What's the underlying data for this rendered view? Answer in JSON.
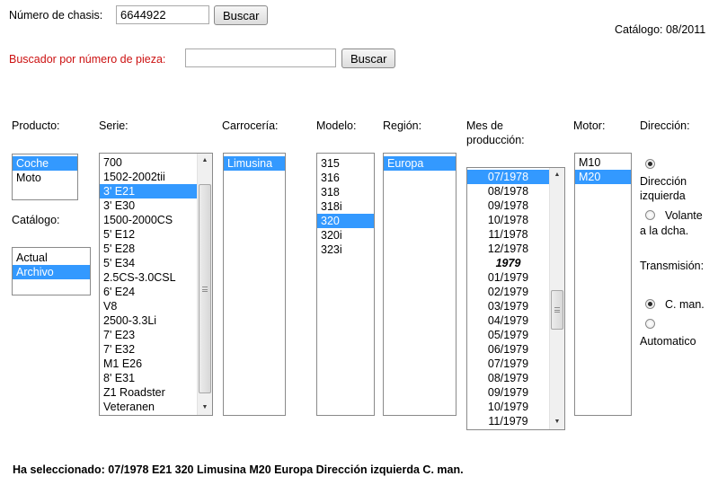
{
  "search": {
    "chassis_label": "Número de chasis:",
    "chassis_value": "6644922",
    "chassis_button": "Buscar",
    "part_label": "Buscador por número de pieza:",
    "part_value": "",
    "part_button": "Buscar"
  },
  "catalog_version": "Catálogo: 08/2011",
  "headers": {
    "producto": "Producto:",
    "catalogo": "Catálogo:",
    "serie": "Serie:",
    "carroceria": "Carrocería:",
    "modelo": "Modelo:",
    "region": "Región:",
    "mes_line1": "Mes de",
    "mes_line2": "producción:",
    "motor": "Motor:",
    "direccion": "Dirección:",
    "transmision": "Transmisión:"
  },
  "producto": {
    "items": [
      "Coche",
      "Moto"
    ],
    "selected": 0
  },
  "catalogo": {
    "items": [
      "Actual",
      "Archivo"
    ],
    "selected": 1
  },
  "serie": {
    "items": [
      "700",
      "1502-2002tii",
      "3' E21",
      "3' E30",
      "1500-2000CS",
      "5' E12",
      "5' E28",
      "5' E34",
      "2.5CS-3.0CSL",
      "6' E24",
      "V8",
      "2500-3.3Li",
      "7' E23",
      "7' E32",
      "M1 E26",
      "8' E31",
      "Z1 Roadster",
      "Veteranen"
    ],
    "selected": 2
  },
  "carroceria": {
    "items": [
      "Limusina"
    ],
    "selected": 0
  },
  "modelo": {
    "items": [
      "315",
      "316",
      "318",
      "318i",
      "320",
      "320i",
      "323i"
    ],
    "selected": 4
  },
  "region": {
    "items": [
      "Europa"
    ],
    "selected": 0
  },
  "mes": {
    "items": [
      "07/1978",
      "08/1978",
      "09/1978",
      "10/1978",
      "11/1978",
      "12/1978",
      "1979",
      "01/1979",
      "02/1979",
      "03/1979",
      "04/1979",
      "05/1979",
      "06/1979",
      "07/1979",
      "08/1979",
      "09/1979",
      "10/1979",
      "11/1979"
    ],
    "selected": 0,
    "headers": [
      6
    ]
  },
  "motor": {
    "items": [
      "M10",
      "M20"
    ],
    "selected": 1
  },
  "direccion": {
    "left_line1": "Dirección",
    "left_line2": "izquierda",
    "right_line1": "Volante",
    "right_line2": "a la dcha.",
    "selected": "left"
  },
  "transmision": {
    "manual": "C. man.",
    "automatic": "Automatico",
    "selected": "manual"
  },
  "summary": "Ha seleccionado: 07/1978 E21 320 Limusina M20 Europa Dirección izquierda C. man."
}
